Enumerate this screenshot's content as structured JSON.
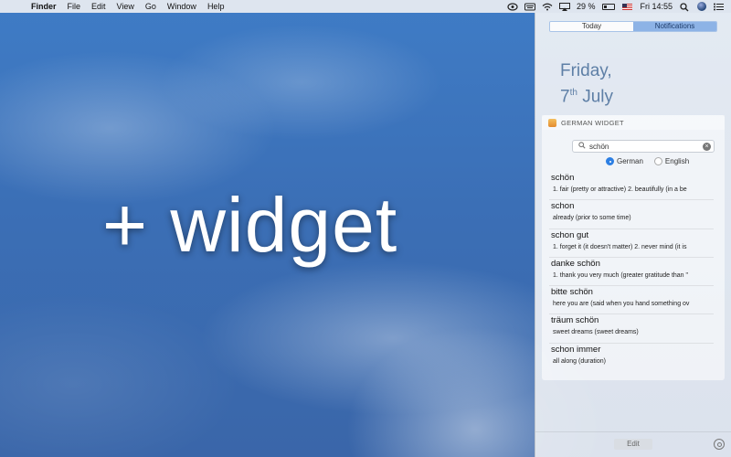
{
  "menubar": {
    "apple": "",
    "app": "Finder",
    "items": [
      "File",
      "Edit",
      "View",
      "Go",
      "Window",
      "Help"
    ],
    "battery": "29 %",
    "clock": "Fri 14:55"
  },
  "desktop": {
    "overlay_text": "+ widget"
  },
  "notification_center": {
    "tabs": {
      "today": "Today",
      "notifications": "Notifications"
    },
    "date": {
      "day": "Friday,",
      "num": "7",
      "suffix": "th",
      "month": "July"
    },
    "widget": {
      "title": "GERMAN WIDGET",
      "search_value": "schön",
      "radio_german": "German",
      "radio_english": "English",
      "results": [
        {
          "word": "schön",
          "definition": "1. fair (pretty or attractive) 2. beautifully (in a be"
        },
        {
          "word": "schon",
          "definition": "already (prior to some time)"
        },
        {
          "word": "schon gut",
          "definition": "1. forget it (it doesn't matter) 2. never mind (it is"
        },
        {
          "word": "danke schön",
          "definition": "1. thank you very much (greater gratitude than \""
        },
        {
          "word": "bitte schön",
          "definition": "here you are (said when you hand something ov"
        },
        {
          "word": "träum schön",
          "definition": "sweet dreams (sweet dreams)"
        },
        {
          "word": "schon immer",
          "definition": "all along (duration)"
        }
      ]
    },
    "edit_label": "Edit"
  }
}
